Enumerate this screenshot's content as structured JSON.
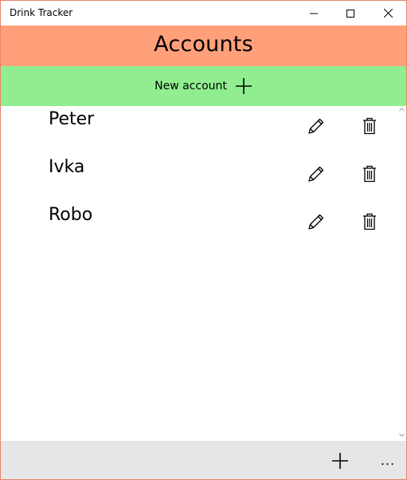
{
  "window": {
    "title": "Drink Tracker"
  },
  "header": {
    "title": "Accounts"
  },
  "new_account": {
    "label": "New account",
    "icon": "plus-icon"
  },
  "accounts": [
    {
      "name": "Peter",
      "edit_icon": "pencil-icon",
      "delete_icon": "trash-icon"
    },
    {
      "name": "Ivka",
      "edit_icon": "pencil-icon",
      "delete_icon": "trash-icon"
    },
    {
      "name": "Robo",
      "edit_icon": "pencil-icon",
      "delete_icon": "trash-icon"
    }
  ],
  "command_bar": {
    "add_icon": "plus-icon",
    "more_label": "..."
  },
  "colors": {
    "header_bg": "#ffa07a",
    "new_account_bg": "#90ee90",
    "command_bar_bg": "#e6e6e6",
    "window_border": "#e8826a"
  }
}
